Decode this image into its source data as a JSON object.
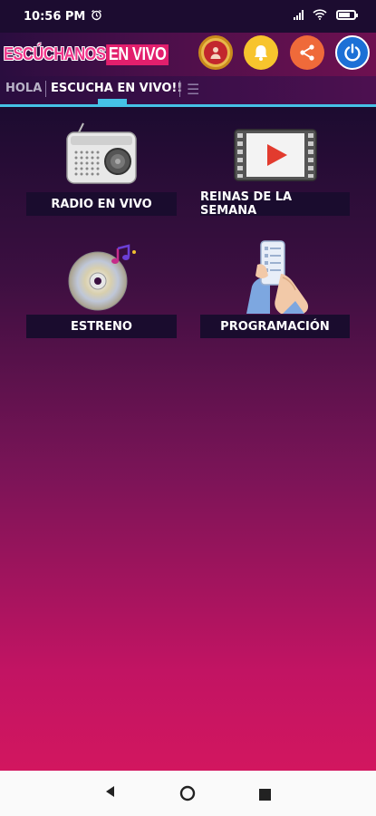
{
  "status_bar": {
    "time": "10:56 PM",
    "battery_icon": "battery-icon",
    "wifi_icon": "wifi-icon",
    "signal_icon": "signal-icon",
    "alarm_icon": "alarm-icon"
  },
  "header": {
    "logo_part1": "ESCÚCHANOS",
    "logo_part2": "EN VIVO",
    "icons": [
      "profile-icon",
      "bell-icon",
      "share-icon",
      "power-icon"
    ]
  },
  "tabs": [
    {
      "label": "HOLA"
    },
    {
      "label": "ESCUCHA EN VIVO!!"
    }
  ],
  "menu_icon": "hamburger-menu-icon",
  "tiles": [
    {
      "label": "RADIO EN VIVO",
      "icon": "radio-icon"
    },
    {
      "label": "REINAS DE LA SEMANA",
      "icon": "video-player-icon"
    },
    {
      "label": "ESTRENO",
      "icon": "music-cd-icon"
    },
    {
      "label": "PROGRAMACIÓN",
      "icon": "schedule-phone-icon"
    }
  ],
  "colors": {
    "accent": "#45c2e6",
    "brand_pink": "#e21f6d",
    "button_bg": "#1a0c2e"
  },
  "nav_bar": {
    "back": "back-icon",
    "home": "home-icon",
    "recents": "recents-icon"
  }
}
